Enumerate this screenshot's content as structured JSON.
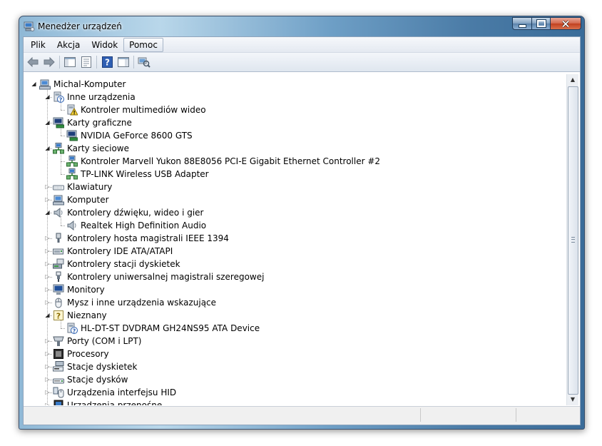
{
  "window": {
    "title": "Menedżer urządzeń"
  },
  "menu": [
    {
      "label": "Plik"
    },
    {
      "label": "Akcja"
    },
    {
      "label": "Widok"
    },
    {
      "label": "Pomoc",
      "active": true
    }
  ],
  "toolbar": [
    {
      "name": "back-button",
      "icon": "arrow-left-icon"
    },
    {
      "name": "forward-button",
      "icon": "arrow-right-icon"
    },
    {
      "name": "show-hide-console-tree-button",
      "icon": "console-tree-icon"
    },
    {
      "name": "properties-button",
      "icon": "properties-icon"
    },
    {
      "name": "help-button",
      "icon": "help-icon"
    },
    {
      "name": "action-pane-button",
      "icon": "action-pane-icon"
    },
    {
      "name": "scan-hardware-button",
      "icon": "scan-hardware-icon"
    }
  ],
  "tree": [
    {
      "label": "Michal-Komputer",
      "level": 0,
      "state": "expanded",
      "icon": "computer-icon"
    },
    {
      "label": "Inne urządzenia",
      "level": 1,
      "state": "expanded",
      "icon": "unknown-device-icon"
    },
    {
      "label": "Kontroler multimediów wideo",
      "level": 2,
      "state": "leaf",
      "icon": "warning-device-icon"
    },
    {
      "label": "Karty graficzne",
      "level": 1,
      "state": "expanded",
      "icon": "display-adapter-icon"
    },
    {
      "label": "NVIDIA GeForce 8600 GTS",
      "level": 2,
      "state": "leaf",
      "icon": "display-adapter-icon"
    },
    {
      "label": "Karty sieciowe",
      "level": 1,
      "state": "expanded",
      "icon": "network-adapter-icon"
    },
    {
      "label": "Kontroler Marvell Yukon 88E8056 PCI-E Gigabit Ethernet Controller #2",
      "level": 2,
      "state": "leaf",
      "icon": "network-adapter-icon"
    },
    {
      "label": "TP-LINK Wireless USB Adapter",
      "level": 2,
      "state": "leaf",
      "icon": "network-adapter-icon"
    },
    {
      "label": "Klawiatury",
      "level": 1,
      "state": "collapsed",
      "icon": "keyboard-icon"
    },
    {
      "label": "Komputer",
      "level": 1,
      "state": "collapsed",
      "icon": "computer-icon"
    },
    {
      "label": "Kontrolery dźwięku, wideo i gier",
      "level": 1,
      "state": "expanded",
      "icon": "speaker-icon"
    },
    {
      "label": "Realtek High Definition Audio",
      "level": 2,
      "state": "leaf",
      "icon": "speaker-icon"
    },
    {
      "label": "Kontrolery hosta magistrali IEEE 1394",
      "level": 1,
      "state": "collapsed",
      "icon": "plug-icon"
    },
    {
      "label": "Kontrolery IDE ATA/ATAPI",
      "level": 1,
      "state": "collapsed",
      "icon": "ide-controller-icon"
    },
    {
      "label": "Kontrolery stacji dyskietek",
      "level": 1,
      "state": "collapsed",
      "icon": "floppy-controller-icon"
    },
    {
      "label": "Kontrolery uniwersalnej magistrali szeregowej",
      "level": 1,
      "state": "collapsed",
      "icon": "usb-plug-icon"
    },
    {
      "label": "Monitory",
      "level": 1,
      "state": "collapsed",
      "icon": "monitor-icon"
    },
    {
      "label": "Mysz i inne urządzenia wskazujące",
      "level": 1,
      "state": "collapsed",
      "icon": "mouse-icon"
    },
    {
      "label": "Nieznany",
      "level": 1,
      "state": "expanded",
      "icon": "unknown-icon"
    },
    {
      "label": "HL-DT-ST DVDRAM GH24NS95 ATA Device",
      "level": 2,
      "state": "leaf",
      "icon": "unknown-device-icon"
    },
    {
      "label": "Porty (COM i LPT)",
      "level": 1,
      "state": "collapsed",
      "icon": "port-icon"
    },
    {
      "label": "Procesory",
      "level": 1,
      "state": "collapsed",
      "icon": "processor-icon"
    },
    {
      "label": "Stacje dyskietek",
      "level": 1,
      "state": "collapsed",
      "icon": "floppy-drive-icon"
    },
    {
      "label": "Stacje dysków",
      "level": 1,
      "state": "collapsed",
      "icon": "disk-drive-icon"
    },
    {
      "label": "Urządzenia interfejsu HID",
      "level": 1,
      "state": "collapsed",
      "icon": "hid-icon"
    },
    {
      "label": "Urządzenia przenośne",
      "level": 1,
      "state": "collapsed",
      "icon": "portable-device-icon"
    }
  ],
  "colors": {
    "accent": "#4a7ba6",
    "tree_line": "#a0a0a0"
  }
}
